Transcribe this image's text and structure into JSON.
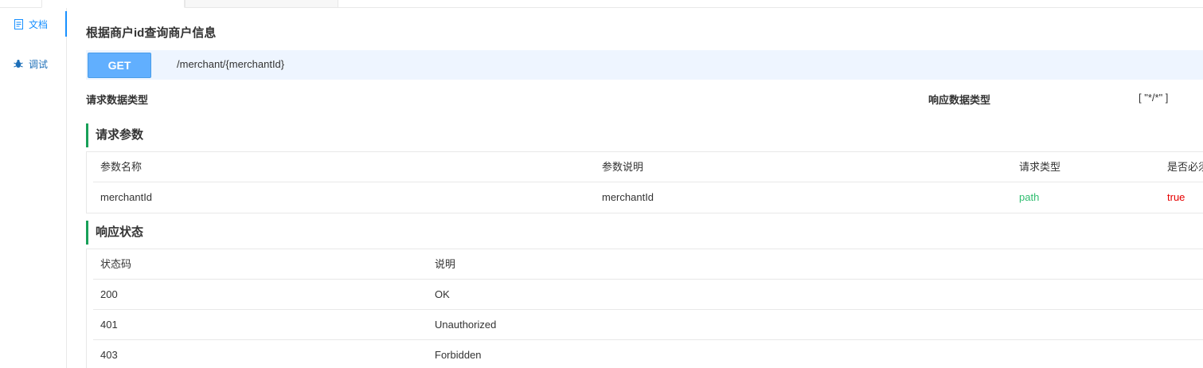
{
  "sidebar": {
    "items": [
      {
        "label": "文档",
        "icon": "document-icon",
        "active": true
      },
      {
        "label": "调试",
        "icon": "bug-icon",
        "active": false
      }
    ]
  },
  "page": {
    "title": "根据商户id查询商户信息",
    "method": "GET",
    "path": "/merchant/{merchantId}",
    "request_type_label": "请求数据类型",
    "response_type_label": "响应数据类型",
    "response_type_value": "[ \"*/*\" ]"
  },
  "params": {
    "title": "请求参数",
    "headers": [
      "参数名称",
      "参数说明",
      "请求类型",
      "是否必须"
    ],
    "rows": [
      [
        "merchantId",
        "merchantId",
        "path",
        "true"
      ]
    ]
  },
  "responses": {
    "title": "响应状态",
    "headers": [
      "状态码",
      "说明"
    ],
    "rows": [
      [
        "200",
        "OK"
      ],
      [
        "401",
        "Unauthorized"
      ],
      [
        "403",
        "Forbidden"
      ]
    ]
  },
  "colors": {
    "accent": "#1890ff",
    "method_bg": "#61affe",
    "section_bar": "#18a058",
    "path_type": "#2fbd6f",
    "required_true": "#e60000"
  }
}
